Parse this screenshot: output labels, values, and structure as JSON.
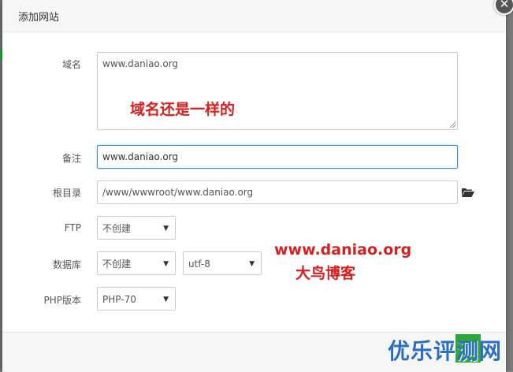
{
  "dialog": {
    "title": "添加网站",
    "close_symbol": "✕"
  },
  "form": {
    "domain": {
      "label": "域名",
      "value": "www.daniao.org"
    },
    "remark": {
      "label": "备注",
      "value": "www.daniao.org"
    },
    "root": {
      "label": "根目录",
      "value": "/www/wwwroot/www.daniao.org"
    },
    "ftp": {
      "label": "FTP",
      "selected": "不创建"
    },
    "database": {
      "label": "数据库",
      "selected": "不创建",
      "charset": "utf-8"
    },
    "php": {
      "label": "PHP版本",
      "selected": "PHP-70"
    }
  },
  "annotations": {
    "domain_note": "域名还是一样的",
    "site_url": "www.daniao.org",
    "blog_name": "大鸟博客",
    "watermark": "优乐评测网"
  },
  "icons": {
    "folder": "folder-open-icon",
    "dropdown": "caret-down-icon"
  },
  "colors": {
    "focus_border": "#2e8ee0",
    "annotation_red": "#d62020",
    "watermark_blue": "#2b6fc4",
    "watermark_green": "#2fa63a"
  }
}
